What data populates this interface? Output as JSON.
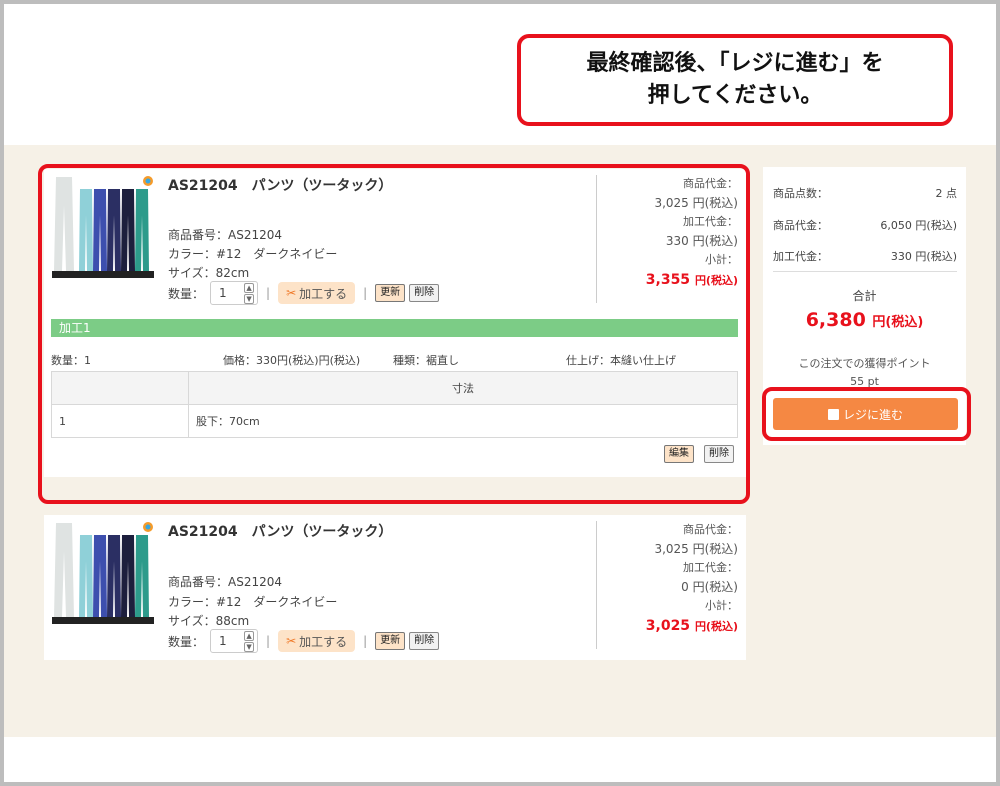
{
  "callout": {
    "line1": "最終確認後、「レジに進む」を",
    "line2": "押してください。"
  },
  "items": [
    {
      "title": "AS21204　パンツ（ツータック）",
      "thumb_caption": "AS21204 パンツ(ツータック)",
      "product_no_label": "商品番号：AS21204",
      "color_label": "カラー：#12　ダークネイビー",
      "size_label": "サイズ：82cm",
      "qty_label": "数量：",
      "qty_value": "1",
      "kakou_label": "加工する",
      "update_label": "更新",
      "delete_label": "削除",
      "price_label": "商品代金：",
      "price_value": "3,025 円(税込)",
      "kakou_price_label": "加工代金：",
      "kakou_price_value": "330 円(税込)",
      "subtotal_label": "小計：",
      "subtotal_value": "3,355",
      "subtotal_unit": "円(税込)",
      "kakou": {
        "band_title": "加工1",
        "qty": "数量：1",
        "price": "価格：330円(税込)円(税込)",
        "type": "種類：裾直し",
        "finish": "仕上げ：本縫い仕上げ",
        "col_header": "寸法",
        "row_no": "1",
        "row_value": "股下：70cm",
        "edit_label": "編集",
        "delete_label": "削除"
      }
    },
    {
      "title": "AS21204　パンツ（ツータック）",
      "thumb_caption": "AS21204 パンツ(ツータック)",
      "product_no_label": "商品番号：AS21204",
      "color_label": "カラー：#12　ダークネイビー",
      "size_label": "サイズ：88cm",
      "qty_label": "数量：",
      "qty_value": "1",
      "kakou_label": "加工する",
      "update_label": "更新",
      "delete_label": "削除",
      "price_label": "商品代金：",
      "price_value": "3,025 円(税込)",
      "kakou_price_label": "加工代金：",
      "kakou_price_value": "0 円(税込)",
      "subtotal_label": "小計：",
      "subtotal_value": "3,025",
      "subtotal_unit": "円(税込)"
    }
  ],
  "summary": {
    "count_label": "商品点数：",
    "count_value": "2 点",
    "goods_label": "商品代金：",
    "goods_value": "6,050 円(税込)",
    "kakou_label": "加工代金：",
    "kakou_value": "330 円(税込)",
    "total_label": "合計",
    "total_value": "6,380",
    "total_unit": "円(税込)",
    "points_label": "この注文での獲得ポイント",
    "points_value": "55 pt",
    "checkout_label": "レジに進む"
  },
  "icons": {
    "scissors": "scissors-icon",
    "register": "register-icon",
    "spin_up": "chevron-up-icon",
    "spin_down": "chevron-down-icon"
  },
  "colors": {
    "highlight_red": "#e8111c",
    "checkout_orange": "#f58843",
    "kakou_green": "#7ccc86",
    "cart_bg": "#f6f1e7"
  }
}
